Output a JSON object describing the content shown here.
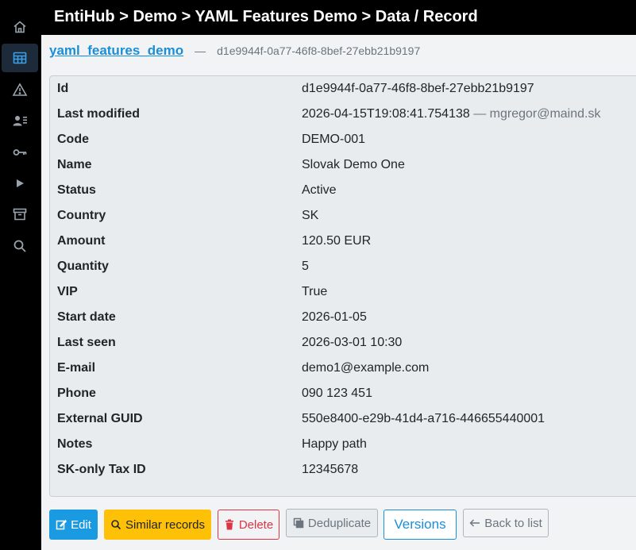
{
  "header": {
    "breadcrumb": "EntiHub > Demo > YAML Features Demo > Data / Record"
  },
  "sidebar": {
    "items": [
      {
        "icon": "home-icon",
        "active": false
      },
      {
        "icon": "table-icon",
        "active": true
      },
      {
        "icon": "warning-icon",
        "active": false
      },
      {
        "icon": "users-icon",
        "active": false
      },
      {
        "icon": "key-icon",
        "active": false
      },
      {
        "icon": "play-icon",
        "active": false
      },
      {
        "icon": "archive-icon",
        "active": false
      },
      {
        "icon": "search-icon",
        "active": false
      }
    ]
  },
  "record": {
    "entity_link": "yaml_features_demo",
    "separator": "—",
    "id": "d1e9944f-0a77-46f8-8bef-27ebb21b9197",
    "fields": [
      {
        "label": "Id",
        "value": "d1e9944f-0a77-46f8-8bef-27ebb21b9197",
        "extra": ""
      },
      {
        "label": "Last modified",
        "value": "2026-04-15T19:08:41.754138",
        "extra": "— mgregor@maind.sk"
      },
      {
        "label": "Code",
        "value": "DEMO-001",
        "extra": ""
      },
      {
        "label": "Name",
        "value": "Slovak Demo One",
        "extra": ""
      },
      {
        "label": "Status",
        "value": "Active",
        "extra": ""
      },
      {
        "label": "Country",
        "value": "SK",
        "extra": ""
      },
      {
        "label": "Amount",
        "value": "120.50 EUR",
        "extra": ""
      },
      {
        "label": "Quantity",
        "value": "5",
        "extra": ""
      },
      {
        "label": "VIP",
        "value": "True",
        "extra": ""
      },
      {
        "label": "Start date",
        "value": "2026-01-05",
        "extra": ""
      },
      {
        "label": "Last seen",
        "value": "2026-03-01 10:30",
        "extra": ""
      },
      {
        "label": "E-mail",
        "value": "demo1@example.com",
        "extra": ""
      },
      {
        "label": "Phone",
        "value": "090 123 451",
        "extra": ""
      },
      {
        "label": "External GUID",
        "value": "550e8400-e29b-41d4-a716-446655440001",
        "extra": ""
      },
      {
        "label": "Notes",
        "value": "Happy path",
        "extra": ""
      },
      {
        "label": "SK-only Tax ID",
        "value": "12345678",
        "extra": ""
      }
    ]
  },
  "actions": {
    "edit": "Edit",
    "similar": "Similar records",
    "delete": "Delete",
    "deduplicate": "Deduplicate",
    "versions": "Versions",
    "back": "Back to list"
  },
  "colors": {
    "accent": "#1a8fd8",
    "warning": "#ffc107",
    "danger": "#dc3545",
    "sidebar_bg": "#000000"
  }
}
